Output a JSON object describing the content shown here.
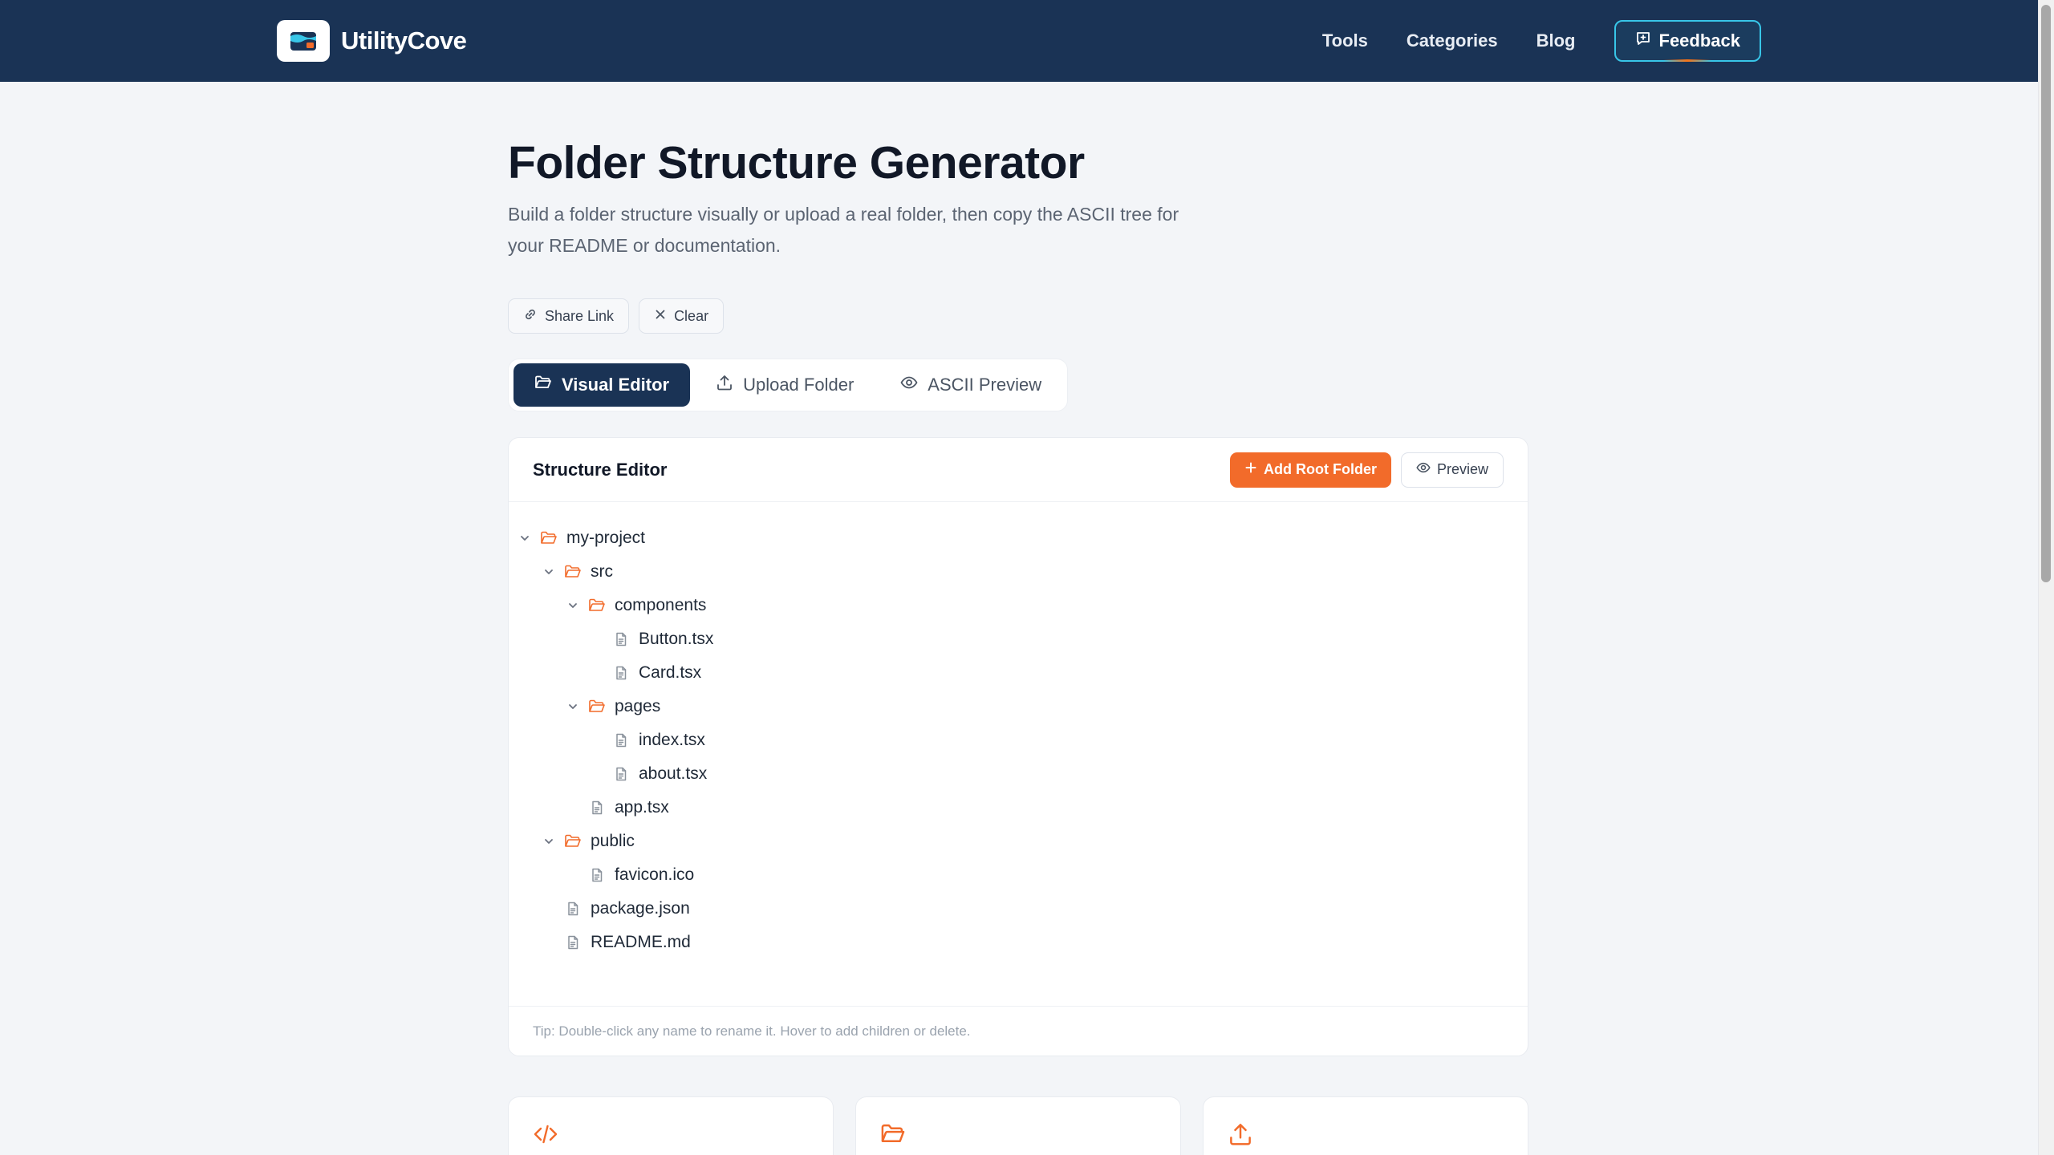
{
  "header": {
    "brand_name": "UtilityCove",
    "nav": [
      "Tools",
      "Categories",
      "Blog"
    ],
    "feedback_label": "Feedback"
  },
  "hero": {
    "title": "Folder Structure Generator",
    "description": "Build a folder structure visually or upload a real folder, then copy the ASCII tree for your README or documentation."
  },
  "actions": {
    "share_label": "Share Link",
    "clear_label": "Clear"
  },
  "tabs": [
    {
      "label": "Visual Editor",
      "icon": "folder-open-icon",
      "active": true
    },
    {
      "label": "Upload Folder",
      "icon": "upload-icon",
      "active": false
    },
    {
      "label": "ASCII Preview",
      "icon": "eye-icon",
      "active": false
    }
  ],
  "editor": {
    "title": "Structure Editor",
    "add_root_label": "Add Root Folder",
    "preview_label": "Preview",
    "tree": [
      {
        "name": "my-project",
        "type": "folder",
        "depth": 0,
        "expanded": true
      },
      {
        "name": "src",
        "type": "folder",
        "depth": 1,
        "expanded": true
      },
      {
        "name": "components",
        "type": "folder",
        "depth": 2,
        "expanded": true
      },
      {
        "name": "Button.tsx",
        "type": "file",
        "depth": 3
      },
      {
        "name": "Card.tsx",
        "type": "file",
        "depth": 3
      },
      {
        "name": "pages",
        "type": "folder",
        "depth": 2,
        "expanded": true
      },
      {
        "name": "index.tsx",
        "type": "file",
        "depth": 3
      },
      {
        "name": "about.tsx",
        "type": "file",
        "depth": 3
      },
      {
        "name": "app.tsx",
        "type": "file",
        "depth": 2
      },
      {
        "name": "public",
        "type": "folder",
        "depth": 1,
        "expanded": true
      },
      {
        "name": "favicon.ico",
        "type": "file",
        "depth": 2
      },
      {
        "name": "package.json",
        "type": "file",
        "depth": 1
      },
      {
        "name": "README.md",
        "type": "file",
        "depth": 1
      }
    ],
    "tip": "Tip: Double-click any name to rename it. Hover to add children or delete."
  },
  "features": [
    {
      "icon": "code-icon"
    },
    {
      "icon": "folder-open-icon"
    },
    {
      "icon": "upload-icon"
    }
  ],
  "colors": {
    "navy": "#1a3355",
    "accent_orange": "#f26b2a",
    "feedback_border": "#38c6e8"
  }
}
